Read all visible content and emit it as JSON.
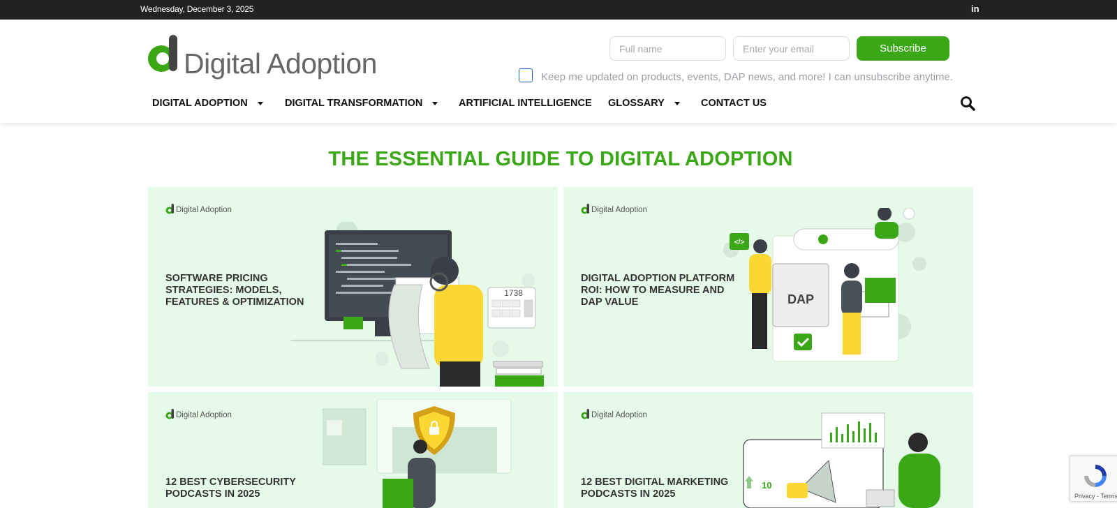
{
  "topbar": {
    "date": "Wednesday, December 3, 2025",
    "social": "in"
  },
  "brand": {
    "name": "Digital Adoption",
    "accent": "#3aa816"
  },
  "subscribe": {
    "name_placeholder": "Full name",
    "email_placeholder": "Enter your email",
    "button": "Subscribe",
    "consent": "Keep me updated on products, events, DAP news, and more! I can unsubscribe anytime."
  },
  "nav": {
    "items": [
      {
        "label": "DIGITAL ADOPTION",
        "has_dropdown": true
      },
      {
        "label": "DIGITAL TRANSFORMATION",
        "has_dropdown": true
      },
      {
        "label": "ARTIFICIAL INTELLIGENCE",
        "has_dropdown": false
      },
      {
        "label": "GLOSSARY",
        "has_dropdown": true
      },
      {
        "label": "CONTACT US",
        "has_dropdown": false
      }
    ],
    "search_icon": "search-icon"
  },
  "main": {
    "title": "THE ESSENTIAL GUIDE TO DIGITAL ADOPTION",
    "cards": [
      {
        "brand": "Digital Adoption",
        "title": "SOFTWARE PRICING STRATEGIES: MODELS, FEATURES & OPTIMIZATION",
        "calc_display": "1738"
      },
      {
        "brand": "Digital Adoption",
        "title": "DIGITAL ADOPTION PLATFORM ROI: HOW TO MEASURE AND DAP VALUE",
        "board_label": "DAP",
        "code_label": "</>"
      },
      {
        "brand": "Digital Adoption",
        "title": "12 BEST CYBERSECURITY PODCASTS IN 2025"
      },
      {
        "brand": "Digital Adoption",
        "title": "12 BEST DIGITAL MARKETING PODCASTS IN 2025",
        "growth_label": "10"
      }
    ]
  },
  "recaptcha": {
    "terms": "Privacy - Terms"
  }
}
